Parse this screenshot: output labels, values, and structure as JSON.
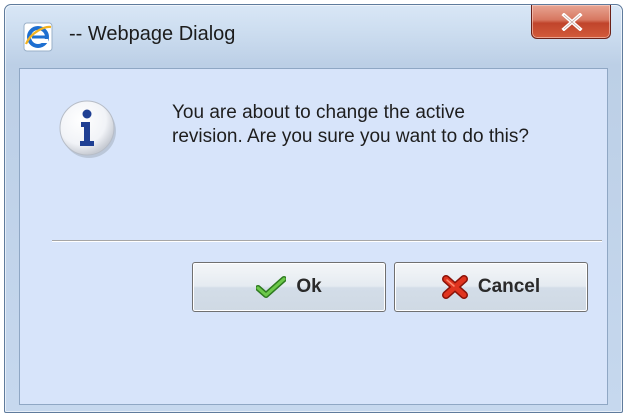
{
  "window": {
    "title": "-- Webpage Dialog",
    "app_icon": "internet-explorer-icon"
  },
  "titlebar": {
    "close_icon": "close-icon",
    "close_label": "X"
  },
  "dialog": {
    "icon": "info-icon",
    "message_line1": "You are about to change the active",
    "message_line2": "revision. Are you sure you want to do this?"
  },
  "buttons": {
    "ok_label": "Ok",
    "ok_icon": "checkmark-icon",
    "cancel_label": "Cancel",
    "cancel_icon": "red-x-icon"
  },
  "colors": {
    "client_background": "#d7e4fa",
    "close_button": "#c0442b",
    "info_blue": "#1f3f93",
    "ok_green": "#3a9a2a",
    "cancel_red": "#d42a1a"
  }
}
